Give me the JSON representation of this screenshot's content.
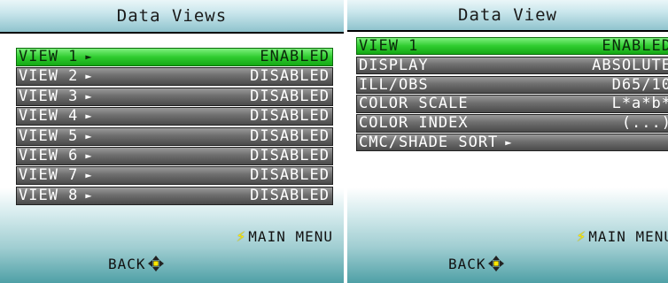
{
  "left_screen": {
    "title": "Data Views",
    "rows": [
      {
        "label": "VIEW 1",
        "value": "ENABLED",
        "arrow": "►"
      },
      {
        "label": "VIEW 2",
        "value": "DISABLED",
        "arrow": "►"
      },
      {
        "label": "VIEW 3",
        "value": "DISABLED",
        "arrow": "►"
      },
      {
        "label": "VIEW 4",
        "value": "DISABLED",
        "arrow": "►"
      },
      {
        "label": "VIEW 5",
        "value": "DISABLED",
        "arrow": "►"
      },
      {
        "label": "VIEW 6",
        "value": "DISABLED",
        "arrow": "►"
      },
      {
        "label": "VIEW 7",
        "value": "DISABLED",
        "arrow": "►"
      },
      {
        "label": "VIEW 8",
        "value": "DISABLED",
        "arrow": "►"
      }
    ],
    "main_menu_label": "MAIN MENU",
    "back_label": "BACK"
  },
  "right_screen": {
    "title": "Data View",
    "rows": [
      {
        "label": "VIEW 1",
        "value": "ENABLED"
      },
      {
        "label": "DISPLAY",
        "value": "ABSOLUTE"
      },
      {
        "label": "ILL/OBS",
        "value": "D65/10"
      },
      {
        "label": "COLOR SCALE",
        "value": "L*a*b*"
      },
      {
        "label": "COLOR INDEX",
        "value": "(...)"
      },
      {
        "label": "CMC/SHADE SORT",
        "value": "",
        "arrow": "►"
      }
    ],
    "main_menu_label": "MAIN MENU",
    "back_label": "BACK"
  },
  "icons": {
    "bolt": "lightning-bolt-icon",
    "dpad": "dpad-arrows-icon"
  },
  "colors": {
    "selected_row": "#2fcc2f",
    "row": "#6e6e6e",
    "bolt": "#ffe800",
    "footer_teal": "#4fa0a6"
  }
}
